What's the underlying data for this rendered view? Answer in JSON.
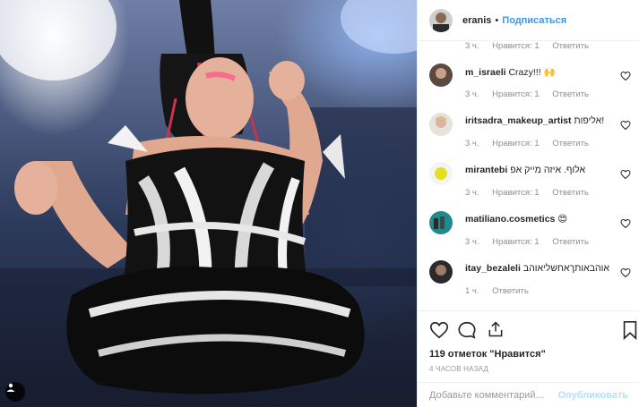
{
  "photo": {
    "alt_icon": "person-tag-icon"
  },
  "header": {
    "username": "eranis",
    "separator": "•",
    "follow_label": "Подписаться"
  },
  "comments": [
    {
      "username": "",
      "text": "",
      "time": "3 ч.",
      "likes": "Нравится: 1",
      "reply": "Ответить"
    },
    {
      "username": "m_israeli",
      "text": "Crazy!!! 🙌",
      "time": "3 ч.",
      "likes": "Нравится: 1",
      "reply": "Ответить"
    },
    {
      "username": "iritsadra_makeup_artist",
      "text": "אליפות!",
      "time": "3 ч.",
      "likes": "Нравится: 1",
      "reply": "Ответить"
    },
    {
      "username": "mirantebi",
      "text": "אלוף. איזה מייק אפ",
      "time": "3 ч.",
      "likes": "Нравится: 1",
      "reply": "Ответить"
    },
    {
      "username": "matiliano.cosmetics",
      "text": "😍",
      "time": "3 ч.",
      "likes": "Нравится: 1",
      "reply": "Ответить"
    },
    {
      "username": "itay_bezaleli",
      "text": "אוהבאותךאחשליאוהב",
      "time": "1 ч.",
      "likes": "",
      "reply": "Ответить"
    }
  ],
  "actions": {
    "likes_count": "119 отметок",
    "likes_word": "\"Нравится\"",
    "time_ago": "4 часов назад"
  },
  "add_comment": {
    "placeholder": "Добавьте комментарий...",
    "post_label": "Опубликовать"
  },
  "colors": {
    "accent": "#3897f0",
    "post_disabled": "#b2dffc"
  }
}
